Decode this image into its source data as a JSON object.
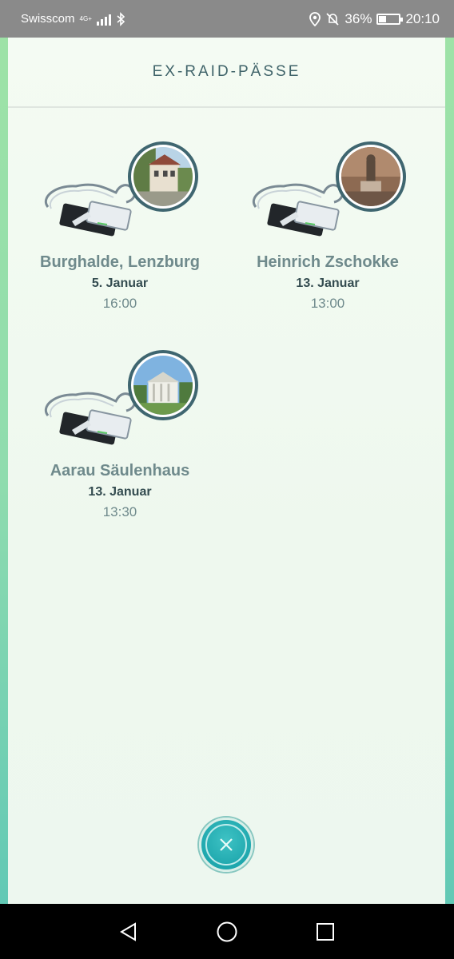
{
  "status_bar": {
    "carrier": "Swisscom",
    "network": "4G+",
    "battery": "36%",
    "time": "20:10"
  },
  "screen": {
    "title": "EX-RAID-PÄSSE"
  },
  "passes": [
    {
      "name": "Burghalde, Lenzburg",
      "date": "5. Januar",
      "time": "16:00",
      "photo": "building-photo"
    },
    {
      "name": "Heinrich Zschokke",
      "date": "13. Januar",
      "time": "13:00",
      "photo": "statue-photo"
    },
    {
      "name": "Aarau Säulenhaus",
      "date": "13. Januar",
      "time": "13:30",
      "photo": "columned-house-photo"
    }
  ],
  "icons": {
    "close": "close-icon",
    "nav_back": "back-triangle-icon",
    "nav_home": "home-circle-icon",
    "nav_recent": "recent-square-icon"
  },
  "colors": {
    "title": "#3f6369",
    "name": "#6f8a8c",
    "date": "#344c50",
    "close_button": "#1ea7ad"
  }
}
